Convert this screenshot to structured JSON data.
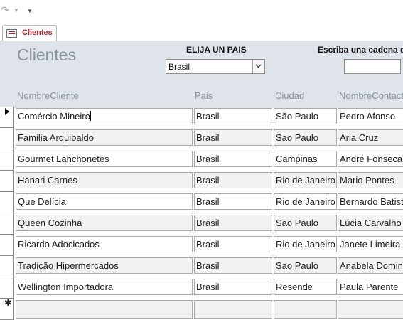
{
  "form": {
    "tab_label": "Clientes",
    "title": "Clientes",
    "country_label": "ELIJA UN PAIS",
    "country_value": "Brasil",
    "search_label": "Escriba una cadena d",
    "search_value": ""
  },
  "columns": [
    "NombreCliente",
    "Pais",
    "Ciudad",
    "NombreContacto"
  ],
  "rows": [
    [
      "Comércio Mineiro",
      "Brasil",
      "São Paulo",
      "Pedro Afonso"
    ],
    [
      "Familia Arquibaldo",
      "Brasil",
      "Sao Paulo",
      "Aria Cruz"
    ],
    [
      "Gourmet Lanchonetes",
      "Brasil",
      "Campinas",
      "André Fonseca"
    ],
    [
      "Hanari Carnes",
      "Brasil",
      "Rio de Janeiro",
      "Mario Pontes"
    ],
    [
      "Que Delícia",
      "Brasil",
      "Rio de Janeiro",
      "Bernardo Batista"
    ],
    [
      "Queen Cozinha",
      "Brasil",
      "Sao Paulo",
      "Lúcia Carvalho"
    ],
    [
      "Ricardo Adocicados",
      "Brasil",
      "Rio de Janeiro",
      "Janete Limeira"
    ],
    [
      "Tradição Hipermercados",
      "Brasil",
      "Sao Paulo",
      "Anabela Domingues"
    ],
    [
      "Wellington Importadora",
      "Brasil",
      "Resende",
      "Paula Parente"
    ]
  ]
}
